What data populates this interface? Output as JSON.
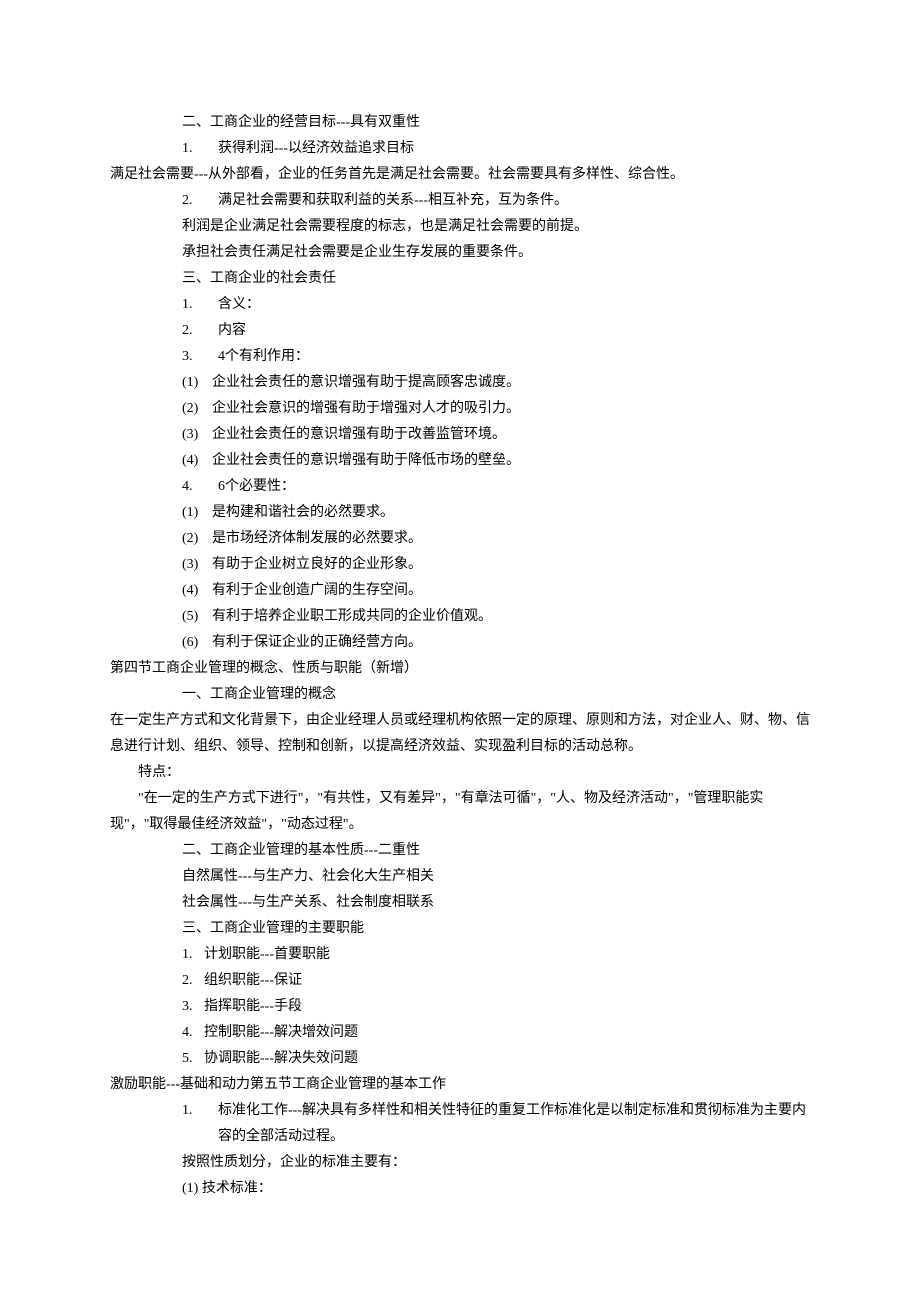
{
  "sec2": {
    "title": "二、工商企业的经营目标---具有双重性",
    "items": [
      {
        "n": "1.",
        "t": "获得利润---以经济效益追求目标"
      }
    ],
    "para1": "满足社会需要---从外部看，企业的任务首先是满足社会需要。社会需要具有多样性、综合性。",
    "items2": [
      {
        "n": "2.",
        "t": "满足社会需要和获取利益的关系---相互补充，互为条件。"
      }
    ],
    "para2": "利润是企业满足社会需要程度的标志，也是满足社会需要的前提。",
    "para3": "承担社会责任满足社会需要是企业生存发展的重要条件。"
  },
  "sec3": {
    "title": "三、工商企业的社会责任",
    "items": [
      {
        "n": "1.",
        "t": "含义："
      },
      {
        "n": "2.",
        "t": "内容"
      },
      {
        "n": "3.",
        "t": "4个有利作用："
      }
    ],
    "benefits": [
      {
        "n": "(1)",
        "t": "企业社会责任的意识增强有助于提高顾客忠诚度。"
      },
      {
        "n": "(2)",
        "t": "企业社会意识的增强有助于增强对人才的吸引力。"
      },
      {
        "n": "(3)",
        "t": "企业社会责任的意识增强有助于改善监管环境。"
      },
      {
        "n": "(4)",
        "t": "企业社会责任的意识增强有助于降低市场的壁垒。"
      }
    ],
    "nec_title": {
      "n": "4.",
      "t": "6个必要性："
    },
    "necessities": [
      {
        "n": "(1)",
        "t": "是构建和谐社会的必然要求。"
      },
      {
        "n": "(2)",
        "t": "是市场经济体制发展的必然要求。"
      },
      {
        "n": "(3)",
        "t": "有助于企业树立良好的企业形象。"
      },
      {
        "n": "(4)",
        "t": "有利于企业创造广阔的生存空间。"
      },
      {
        "n": "(5)",
        "t": "有利于培养企业职工形成共同的企业价值观。"
      },
      {
        "n": "(6)",
        "t": "有利于保证企业的正确经营方向。"
      }
    ]
  },
  "sec4": {
    "heading": "第四节工商企业管理的概念、性质与职能（新增）",
    "s1_title": "一、工商企业管理的概念",
    "s1_para": "在一定生产方式和文化背景下，由企业经理人员或经理机构依照一定的原理、原则和方法，对企业人、财、物、信息进行计划、组织、领导、控制和创新，以提高经济效益、实现盈利目标的活动总称。",
    "feat_label": "特点：",
    "feat_text": "　　\"在一定的生产方式下进行\"，\"有共性，又有差异\"，\"有章法可循\"，\"人、物及经济活动\"，\"管理职能实现\"，\"取得最佳经济效益\"，\"动态过程\"。",
    "s2_title": "二、工商企业管理的基本性质---二重性",
    "s2_l1": "自然属性---与生产力、社会化大生产相关",
    "s2_l2": "社会属性---与生产关系、社会制度相联系",
    "s3_title": "三、工商企业管理的主要职能",
    "funcs": [
      {
        "n": "1.",
        "t": "计划职能---首要职能"
      },
      {
        "n": "2.",
        "t": "组织职能---保证"
      },
      {
        "n": "3.",
        "t": "指挥职能---手段"
      },
      {
        "n": "4.",
        "t": "控制职能---解决增效问题"
      },
      {
        "n": "5.",
        "t": "协调职能---解决失效问题"
      }
    ]
  },
  "sec5": {
    "heading": "激励职能---基础和动力第五节工商企业管理的基本工作",
    "items": [
      {
        "n": "1.",
        "t": "标准化工作---解决具有多样性和相关性特征的重复工作标准化是以制定标准和贯彻标准为主要内容的全部活动过程。"
      }
    ],
    "para1": "按照性质划分，企业的标准主要有：",
    "sub1": "(1) 技术标准："
  }
}
